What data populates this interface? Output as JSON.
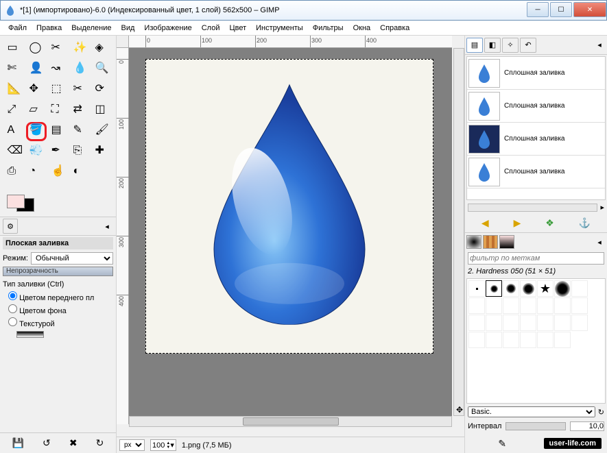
{
  "window": {
    "title": "*[1] (импортировано)-6.0 (Индексированный цвет, 1 слой) 562x500 – GIMP"
  },
  "menu": {
    "file": "Файл",
    "edit": "Правка",
    "select": "Выделение",
    "view": "Вид",
    "image": "Изображение",
    "layer": "Слой",
    "color": "Цвет",
    "tools": "Инструменты",
    "filters": "Фильтры",
    "windows": "Окна",
    "help": "Справка"
  },
  "toolbox": {
    "tools": [
      "rect-select",
      "ellipse-select",
      "free-select",
      "fuzzy-select",
      "color-select",
      "scissors",
      "foreground",
      "paths",
      "picker",
      "zoom",
      "measure",
      "move",
      "align",
      "crop",
      "rotate",
      "scale",
      "shear",
      "perspective",
      "flip",
      "cage",
      "text",
      "bucket-fill",
      "blend",
      "pencil",
      "paintbrush",
      "eraser",
      "airbrush",
      "ink",
      "clone",
      "heal",
      "perspective-clone",
      "blur",
      "smudge",
      "dodge"
    ],
    "highlighted_index": 21
  },
  "tool_options": {
    "title": "Плоская заливка",
    "mode_label": "Режим:",
    "mode_value": "Обычный",
    "opacity_label": "Непрозрачность",
    "fill_type_label": "Тип заливки (Ctrl)",
    "fill_fg": "Цветом переднего пл",
    "fill_bg": "Цветом фона",
    "fill_pattern": "Текстурой"
  },
  "ruler": {
    "h": [
      "0",
      "100",
      "200",
      "300",
      "400"
    ],
    "v": [
      "0",
      "100",
      "200",
      "300",
      "400"
    ]
  },
  "status": {
    "unit": "px",
    "zoom": "100",
    "filename": "1.png (7,5 МБ)"
  },
  "layers": [
    {
      "name": "Сплошная заливка",
      "bg": "light"
    },
    {
      "name": "Сплошная заливка",
      "bg": "light"
    },
    {
      "name": "Сплошная заливка",
      "bg": "dark"
    },
    {
      "name": "Сплошная заливка",
      "bg": "light"
    }
  ],
  "brush": {
    "filter_placeholder": "фильтр по меткам",
    "info": "2. Hardness 050 (51 × 51)",
    "preset_label": "Basic.",
    "interval_label": "Интервал",
    "interval_value": "10,0"
  },
  "brand": "user-life.com"
}
